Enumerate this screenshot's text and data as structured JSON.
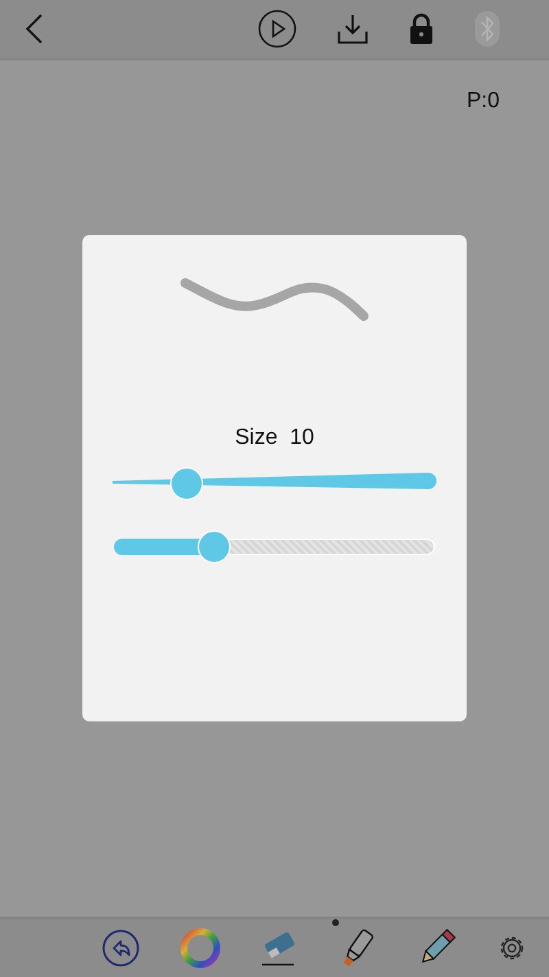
{
  "top_bar": {
    "bluetooth": {
      "disabled": true
    }
  },
  "canvas": {
    "points": "P:0"
  },
  "brush_panel": {
    "size_label": "Size  10",
    "size_slider": {
      "level": 0.23
    },
    "opacity_slider": {
      "level": 0.31
    }
  },
  "toolbar": {
    "tools": [
      {
        "kind": "undo",
        "selected": false
      },
      {
        "kind": "color",
        "selected": false
      },
      {
        "kind": "eraser",
        "selected": false
      },
      {
        "kind": "marker",
        "selected": true
      },
      {
        "kind": "pencil",
        "selected": false
      },
      {
        "kind": "settings",
        "selected": false
      }
    ]
  }
}
